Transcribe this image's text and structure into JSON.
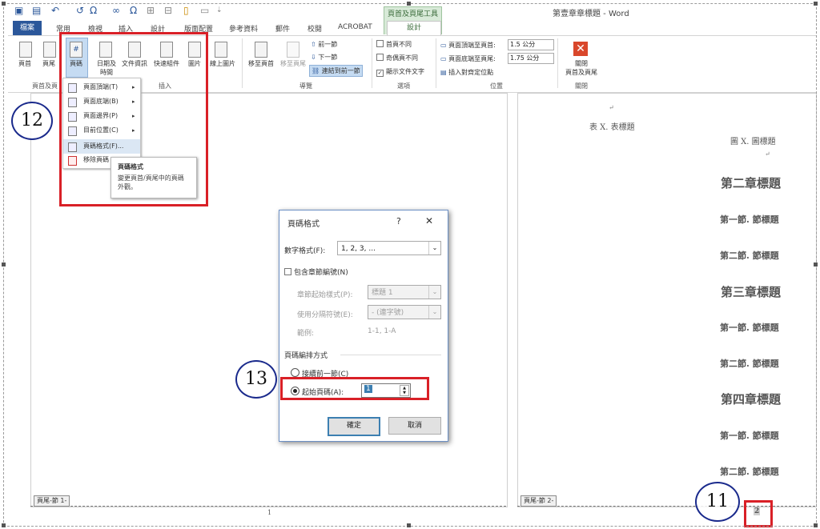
{
  "window": {
    "title": "第壹章章標題 - Word",
    "context_tab_title": "頁首及頁尾工具",
    "qat_symbols": [
      "Ω",
      "∞",
      "Ω"
    ]
  },
  "tabs": [
    "檔案",
    "常用",
    "檢視",
    "插入",
    "設計",
    "版面配置",
    "參考資料",
    "郵件",
    "校閱",
    "ACROBAT",
    "設計"
  ],
  "ribbon": {
    "buttons": {
      "header": "頁首",
      "footer": "頁尾",
      "page_number": "頁碼",
      "date_time": "日期及\n時間",
      "doc_info": "文件資訊",
      "quick_parts": "快速組件",
      "pictures": "圖片",
      "online_pictures": "線上圖片",
      "goto_header": "移至頁首",
      "goto_footer": "移至頁尾",
      "previous": "前一節",
      "next": "下一節",
      "link_previous": "連結到前一節",
      "close": "關閉\n頁首及頁尾"
    },
    "options": {
      "different_first": "首頁不同",
      "different_odd_even": "奇偶頁不同",
      "show_text": "顯示文件文字"
    },
    "position": {
      "header_top_label": "頁面頂端至頁首:",
      "header_top_value": "1.5 公分",
      "footer_bottom_label": "頁面底端至頁尾:",
      "footer_bottom_value": "1.75 公分",
      "insert_align_tab": "插入對齊定位點"
    },
    "groups": [
      "頁首及頁",
      "插入",
      "導覽",
      "選項",
      "位置",
      "關閉"
    ]
  },
  "page_number_menu": {
    "items": [
      "頁面頂端(T)",
      "頁面底端(B)",
      "頁面邊界(P)",
      "目前位置(C)",
      "頁碼格式(F)...",
      "移除頁碼"
    ],
    "tooltip_title": "頁碼格式",
    "tooltip_body": "變更頁首/頁尾中的頁碼外觀。"
  },
  "dialog": {
    "title": "頁碼格式",
    "help": "?",
    "close": "✕",
    "number_format_label": "數字格式(F):",
    "number_format_value": "1, 2, 3, ...",
    "include_chapter": "包含章節編號(N)",
    "chapter_style_label": "章節起始樣式(P):",
    "chapter_style_value": "標題 1",
    "separator_label": "使用分隔符號(E):",
    "separator_value": "-  (連字號)",
    "example_label": "範例:",
    "example_value": "1-1, 1-A",
    "numbering_section": "頁碼編排方式",
    "continue_option": "接續前一節(C)",
    "start_at_option": "起始頁碼(A):",
    "start_at_value": "1",
    "ok": "確定",
    "cancel": "取消"
  },
  "document": {
    "table_caption": "表 X. 表標題",
    "figure_caption": "圖 X. 圖標題",
    "headings": [
      {
        "text": "第二章標題",
        "level": 1
      },
      {
        "text": "第一節. 節標題",
        "level": 2
      },
      {
        "text": "第二節. 節標題",
        "level": 2
      },
      {
        "text": "第三章標題",
        "level": 1
      },
      {
        "text": "第一節. 節標題",
        "level": 2
      },
      {
        "text": "第二節. 節標題",
        "level": 2
      },
      {
        "text": "第四章標題",
        "level": 1
      },
      {
        "text": "第一節. 節標題",
        "level": 2
      },
      {
        "text": "第二節. 節標題",
        "level": 2
      }
    ],
    "footer_tag_left": "頁尾-節 1-",
    "footer_tag_right": "頁尾-節 2-",
    "page1_number": "1",
    "page2_number": "2"
  },
  "annotations": {
    "step11": "11",
    "step12": "12",
    "step13": "13"
  },
  "colors": {
    "accent": "#2b579a",
    "highlight_red": "#d92027",
    "circle_border": "#1a2a8c"
  }
}
